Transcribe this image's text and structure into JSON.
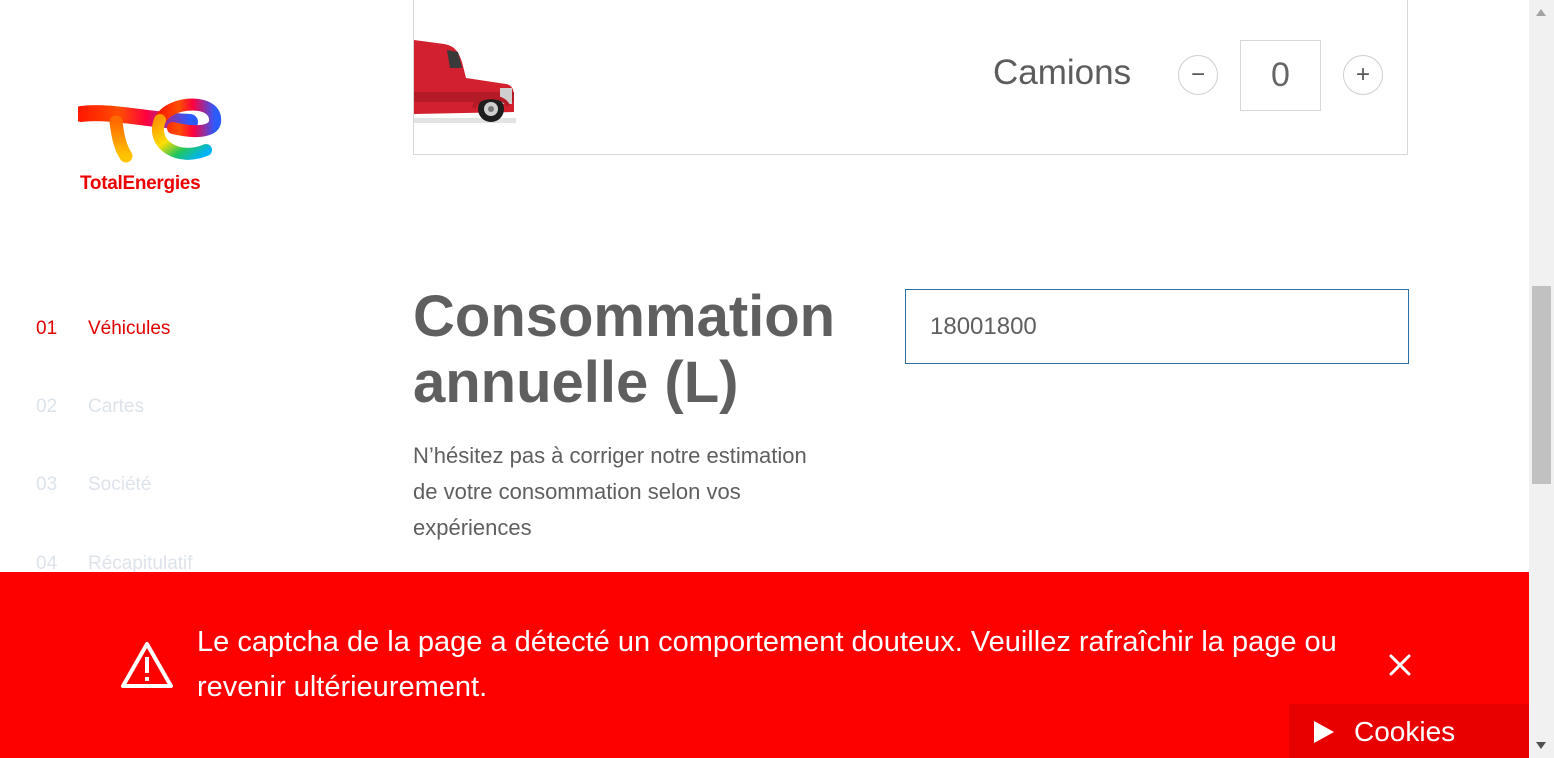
{
  "logo": {
    "text": "TotalEnergies"
  },
  "steps": [
    {
      "num": "01",
      "label": "Véhicules",
      "state": "active"
    },
    {
      "num": "02",
      "label": "Cartes",
      "state": "inactive"
    },
    {
      "num": "03",
      "label": "Société",
      "state": "inactive"
    },
    {
      "num": "04",
      "label": "Récapitulatif",
      "state": "inactive"
    }
  ],
  "vehicle": {
    "label": "Camions",
    "quantity": "0",
    "decrement_symbol": "−",
    "increment_symbol": "+"
  },
  "consumption": {
    "title": "Consommation annuelle (L)",
    "description": "N’hésitez pas à corriger notre estimation de votre consommation selon vos expériences",
    "value": "18001800"
  },
  "alert": {
    "message": "Le captcha de la page a détecté un comportement douteux. Veuillez rafraîchir la page ou revenir ultérieurement.",
    "icon": "warning-triangle-icon",
    "close_icon": "close-icon"
  },
  "cookies": {
    "label": "Cookies",
    "icon": "play-icon"
  },
  "colors": {
    "brand_red": "#ed0000",
    "alert_red": "#fd0000",
    "active_step": "#e00000",
    "inactive_step": "#dde3ea",
    "input_border": "#2e6da0"
  }
}
